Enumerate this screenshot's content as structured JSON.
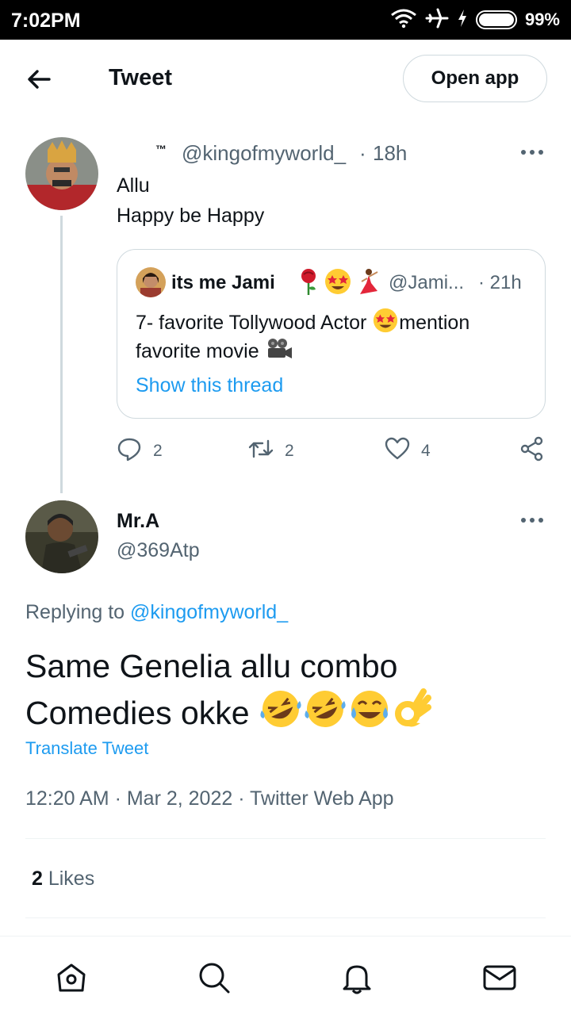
{
  "status_bar": {
    "time": "7:02PM",
    "battery": "99%",
    "icons": [
      "wifi-icon",
      "airplane-icon",
      "charging-icon",
      "battery-icon"
    ]
  },
  "header": {
    "title": "Tweet",
    "open_app_label": "Open app"
  },
  "parent_tweet": {
    "display_name_suffix": "™",
    "handle": "@kingofmyworld_",
    "time_sep": "·",
    "time": "18h",
    "line1": "Allu",
    "line2": "Happy be Happy",
    "quote": {
      "name": "its me Jami",
      "name_emojis": [
        "rose",
        "star-struck",
        "dancer"
      ],
      "handle": "@Jami...",
      "time": "· 21h",
      "text_part1": "7- favorite Tollywood Actor ",
      "text_part2": "mention",
      "text_line2": "favorite movie ",
      "show_thread": "Show this thread"
    },
    "actions": {
      "replies": "2",
      "retweets": "2",
      "likes": "4"
    }
  },
  "main_tweet": {
    "display_name": "Mr.A",
    "handle": "@369Atp",
    "replying_prefix": "Replying to ",
    "replying_handle": "@kingofmyworld_",
    "text_line1": "Same Genelia allu combo",
    "text_line2": "Comedies okke ",
    "text_emojis": [
      "rofl",
      "rofl",
      "tears-of-joy",
      "ok-hand"
    ],
    "translate": "Translate Tweet",
    "timestamp": "12:20 AM · Mar 2, 2022 · Twitter Web App",
    "likes_count": "2",
    "likes_label": " Likes"
  },
  "bottom_nav": [
    "home-icon",
    "search-icon",
    "notifications-icon",
    "messages-icon"
  ],
  "colors": {
    "accent": "#1d9bf0",
    "text": "#0f1419",
    "muted": "#536471",
    "border": "#cfd9de"
  }
}
